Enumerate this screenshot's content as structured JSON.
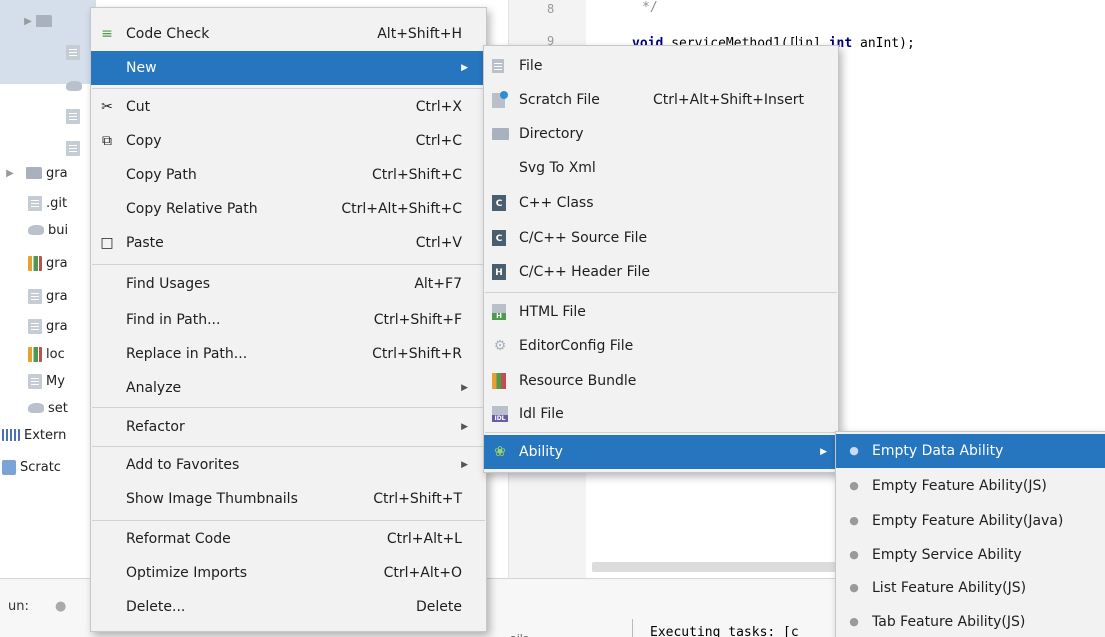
{
  "project_tree": {
    "items": [
      {
        "label": "gra"
      },
      {
        "label": ".git"
      },
      {
        "label": "bui"
      },
      {
        "label": "gra"
      },
      {
        "label": "gra"
      },
      {
        "label": "gra"
      },
      {
        "label": "loc"
      },
      {
        "label": "My"
      },
      {
        "label": "set"
      },
      {
        "label": "Extern"
      },
      {
        "label": "Scratc"
      }
    ]
  },
  "editor": {
    "gutter_lines": [
      "8",
      "9"
    ],
    "line_comment": "*/",
    "code": {
      "kw1": "void",
      "part1": " serviceMethod1([",
      "part2": "in] ",
      "kw2": "int",
      "part3": " anInt);"
    }
  },
  "bottom": {
    "run_label": "un:",
    "console_text": "Executing tasks: [c",
    "hint": "ails"
  },
  "context_menu": {
    "items": [
      {
        "label": "Code Check",
        "shortcut": "Alt+Shift+H",
        "icon": "code-check-icon"
      },
      {
        "label": "New",
        "submenu": true,
        "selected": true
      },
      {
        "label": "Cut",
        "shortcut": "Ctrl+X",
        "icon": "scissors-icon"
      },
      {
        "label": "Copy",
        "shortcut": "Ctrl+C",
        "icon": "copy-icon"
      },
      {
        "label": "Copy Path",
        "shortcut": "Ctrl+Shift+C"
      },
      {
        "label": "Copy Relative Path",
        "shortcut": "Ctrl+Alt+Shift+C"
      },
      {
        "label": "Paste",
        "shortcut": "Ctrl+V",
        "icon": "clipboard-icon"
      },
      {
        "label": "Find Usages",
        "shortcut": "Alt+F7"
      },
      {
        "label": "Find in Path...",
        "shortcut": "Ctrl+Shift+F"
      },
      {
        "label": "Replace in Path...",
        "shortcut": "Ctrl+Shift+R"
      },
      {
        "label": "Analyze",
        "submenu": true
      },
      {
        "label": "Refactor",
        "submenu": true
      },
      {
        "label": "Add to Favorites",
        "submenu": true
      },
      {
        "label": "Show Image Thumbnails",
        "shortcut": "Ctrl+Shift+T"
      },
      {
        "label": "Reformat Code",
        "shortcut": "Ctrl+Alt+L"
      },
      {
        "label": "Optimize Imports",
        "shortcut": "Ctrl+Alt+O"
      },
      {
        "label": "Delete...",
        "shortcut": "Delete"
      }
    ]
  },
  "new_submenu": {
    "items": [
      {
        "label": "File",
        "icon": "file-icon"
      },
      {
        "label": "Scratch File",
        "shortcut": "Ctrl+Alt+Shift+Insert",
        "icon": "scratch-file-icon"
      },
      {
        "label": "Directory",
        "icon": "folder-icon"
      },
      {
        "label": "Svg To Xml"
      },
      {
        "label": "C++ Class",
        "icon": "cpp-class-icon"
      },
      {
        "label": "C/C++ Source File",
        "icon": "cpp-source-icon"
      },
      {
        "label": "C/C++ Header File",
        "icon": "cpp-header-icon"
      },
      {
        "label": "HTML File",
        "icon": "html-file-icon"
      },
      {
        "label": "EditorConfig File",
        "icon": "gear-icon"
      },
      {
        "label": "Resource Bundle",
        "icon": "resource-bundle-icon"
      },
      {
        "label": "Idl File",
        "icon": "idl-file-icon"
      },
      {
        "label": "Ability",
        "submenu": true,
        "selected": true,
        "icon": "ability-icon"
      }
    ]
  },
  "ability_submenu": {
    "items": [
      {
        "label": "Empty Data Ability",
        "selected": true
      },
      {
        "label": "Empty Feature Ability(JS)"
      },
      {
        "label": "Empty Feature Ability(Java)"
      },
      {
        "label": "Empty Service Ability"
      },
      {
        "label": "List Feature Ability(JS)"
      },
      {
        "label": "Tab Feature Ability(JS)"
      }
    ]
  },
  "colors": {
    "selection": "#2675bf",
    "menu_background": "#f2f2f2",
    "tree_selection": "#d5dfec",
    "keyword": "#000080"
  }
}
